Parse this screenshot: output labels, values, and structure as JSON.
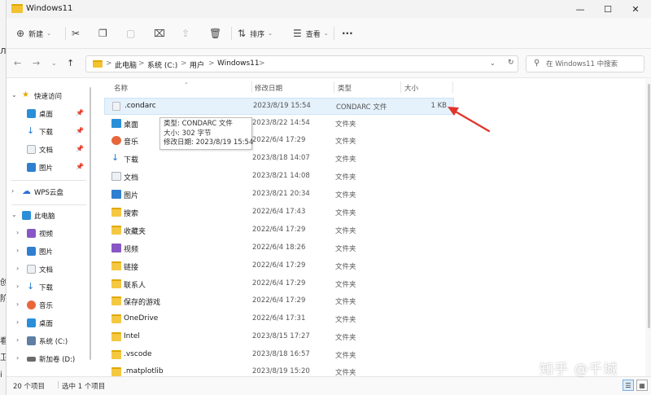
{
  "edge_chars": [
    "Л",
    "创",
    "阶",
    "看",
    "卫",
    "i"
  ],
  "window": {
    "title": "Windows11",
    "controls": {
      "minimize": "—",
      "maximize": "☐",
      "close": "✕"
    }
  },
  "toolbar": {
    "new_label": "新建",
    "sort_label": "排序",
    "view_label": "查看",
    "more": "···"
  },
  "address": {
    "crumbs": [
      "此电脑",
      "系统 (C:)",
      "用户",
      "Windows11"
    ],
    "separator": ">",
    "search_placeholder": "在 Windows11 中搜索"
  },
  "sidebar": {
    "quick_access": "快速访问",
    "quick_items": [
      "桌面",
      "下载",
      "文档",
      "图片"
    ],
    "wps": "WPS云盘",
    "this_pc": "此电脑",
    "pc_items": [
      "视频",
      "图片",
      "文档",
      "下载",
      "音乐",
      "桌面",
      "系统 (C:)",
      "新加卷 (D:)"
    ]
  },
  "columns": {
    "name": "名称",
    "date": "修改日期",
    "type": "类型",
    "size": "大小"
  },
  "files": [
    {
      "name": ".condarc",
      "date": "2023/8/19 15:54",
      "type": "CONDARC 文件",
      "size": "1 KB",
      "icon": "file-icon"
    },
    {
      "name": "桌面",
      "date": "2023/8/22 14:54",
      "type": "文件夹",
      "size": "",
      "icon": "desktop-folder-icon"
    },
    {
      "name": "音乐",
      "date": "2022/6/4 17:29",
      "type": "文件夹",
      "size": "",
      "icon": "music-folder-icon"
    },
    {
      "name": "下载",
      "date": "2023/8/18 14:07",
      "type": "文件夹",
      "size": "",
      "icon": "downloads-folder-icon"
    },
    {
      "name": "文档",
      "date": "2023/8/21 14:08",
      "type": "文件夹",
      "size": "",
      "icon": "documents-folder-icon"
    },
    {
      "name": "图片",
      "date": "2023/8/21 20:34",
      "type": "文件夹",
      "size": "",
      "icon": "pictures-folder-icon"
    },
    {
      "name": "搜索",
      "date": "2022/6/4 17:43",
      "type": "文件夹",
      "size": "",
      "icon": "folder-icon"
    },
    {
      "name": "收藏夹",
      "date": "2022/6/4 17:29",
      "type": "文件夹",
      "size": "",
      "icon": "folder-icon"
    },
    {
      "name": "视频",
      "date": "2022/6/4 18:26",
      "type": "文件夹",
      "size": "",
      "icon": "videos-folder-icon"
    },
    {
      "name": "链接",
      "date": "2022/6/4 17:29",
      "type": "文件夹",
      "size": "",
      "icon": "folder-icon"
    },
    {
      "name": "联系人",
      "date": "2022/6/4 17:29",
      "type": "文件夹",
      "size": "",
      "icon": "folder-icon"
    },
    {
      "name": "保存的游戏",
      "date": "2022/6/4 17:29",
      "type": "文件夹",
      "size": "",
      "icon": "folder-icon"
    },
    {
      "name": "OneDrive",
      "date": "2022/6/4 17:31",
      "type": "文件夹",
      "size": "",
      "icon": "folder-icon"
    },
    {
      "name": "Intel",
      "date": "2023/8/15 17:27",
      "type": "文件夹",
      "size": "",
      "icon": "folder-icon"
    },
    {
      "name": ".vscode",
      "date": "2023/8/18 16:57",
      "type": "文件夹",
      "size": "",
      "icon": "folder-icon"
    },
    {
      "name": ".matplotlib",
      "date": "2023/8/19 15:20",
      "type": "文件夹",
      "size": "",
      "icon": "folder-icon"
    }
  ],
  "tooltip": {
    "type_line": "类型: CONDARC 文件",
    "size_line": "大小: 302 字节",
    "date_line": "修改日期: 2023/8/19 15:54"
  },
  "status": {
    "count": "20 个项目",
    "selected": "选中 1 个项目"
  },
  "watermark": "知乎 @千城",
  "colors": {
    "accent": "#0067c0",
    "selection": "#e5f1fb",
    "arrow": "#e0342a",
    "folder": "#f5c842"
  }
}
